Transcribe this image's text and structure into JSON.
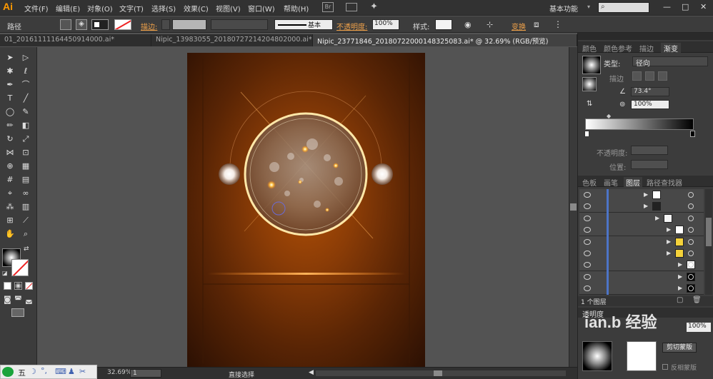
{
  "app": {
    "logo": "Ai"
  },
  "menubar": {
    "items": [
      "文件(F)",
      "编辑(E)",
      "对象(O)",
      "文字(T)",
      "选择(S)",
      "效果(C)",
      "视图(V)",
      "窗口(W)",
      "帮助(H)"
    ],
    "workspace": "基本功能",
    "search_icon": "search-icon",
    "bridge_label": "Br",
    "minimize": "—",
    "restore": "□",
    "close": "✕"
  },
  "control": {
    "context": "路径",
    "stroke_label": "描边:",
    "brush_label": "基本",
    "opacity_label": "不透明度:",
    "opacity_value": "100%",
    "style_label": "样式:",
    "transform_label": "变换"
  },
  "tabs": [
    {
      "label": "01_20161111164450914000.ai*",
      "active": false
    },
    {
      "label": "Nipic_13983055_20180727214204802000.ai*",
      "active": false
    },
    {
      "label": "Nipic_23771846_20180722000148325083.ai* @ 32.69% (RGB/预览)",
      "active": true
    }
  ],
  "tools": [
    [
      "selection-arrow-icon",
      "direct-selection-icon"
    ],
    [
      "magic-wand-icon",
      "lasso-icon"
    ],
    [
      "pen-icon",
      "curvature-icon"
    ],
    [
      "type-icon",
      "line-segment-icon"
    ],
    [
      "ellipse-icon",
      "paintbrush-icon"
    ],
    [
      "pencil-icon",
      "eraser-icon"
    ],
    [
      "rotate-icon",
      "scale-icon"
    ],
    [
      "width-icon",
      "free-transform-icon"
    ],
    [
      "shape-builder-icon",
      "perspective-grid-icon"
    ],
    [
      "mesh-icon",
      "gradient-icon"
    ],
    [
      "eyedropper-icon",
      "blend-icon"
    ],
    [
      "symbol-sprayer-icon",
      "column-graph-icon"
    ],
    [
      "artboard-icon",
      "slice-icon"
    ],
    [
      "hand-icon",
      "zoom-icon"
    ]
  ],
  "tool_glyphs": {
    "selection-arrow-icon": "➤",
    "direct-selection-icon": "▷",
    "magic-wand-icon": "✱",
    "lasso-icon": "ℓ",
    "pen-icon": "✒",
    "curvature-icon": "⌒",
    "type-icon": "T",
    "line-segment-icon": "╱",
    "ellipse-icon": "◯",
    "paintbrush-icon": "✎",
    "pencil-icon": "✏",
    "eraser-icon": "◧",
    "rotate-icon": "↻",
    "scale-icon": "⤢",
    "width-icon": "⋈",
    "free-transform-icon": "⊡",
    "shape-builder-icon": "⊕",
    "perspective-grid-icon": "▦",
    "mesh-icon": "#",
    "gradient-icon": "▤",
    "eyedropper-icon": "⌖",
    "blend-icon": "∞",
    "symbol-sprayer-icon": "⁂",
    "column-graph-icon": "▥",
    "artboard-icon": "⊞",
    "slice-icon": "⟋",
    "hand-icon": "✋",
    "zoom-icon": "⌕"
  },
  "status": {
    "zoom": "32.69%",
    "artboard_number": "1",
    "tool_name": "直接选择"
  },
  "panels": {
    "top_tabs": [
      "颜色",
      "颜色参考",
      "描边",
      "渐变"
    ],
    "active_top_tab": "渐变",
    "gradient": {
      "type_label": "类型:",
      "type_value": "径向",
      "stroke_label": "描边",
      "angle_value": "73.4°",
      "aspect_value": "100%",
      "opacity_label": "不透明度:",
      "position_label": "位置:"
    },
    "mid_tabs": [
      "色板",
      "画笔",
      "图层",
      "路径查找器"
    ],
    "active_mid_tab": "图层",
    "layers_footer": "1 个图层",
    "bottom_label": "透明度",
    "bottom_opacity_value": "100%",
    "clip_button": "剪切蒙版",
    "invert_label": "反相蒙版"
  },
  "taskbar": {
    "ime_label": "五",
    "zoom_left": "%"
  },
  "watermark": {
    "text": "ian.b 经验"
  },
  "colors": {
    "accent": "#ff9a00",
    "artboard_dark": "#2b1003",
    "artboard_glow": "#b04f06",
    "layer_bar": "#4d74c6"
  }
}
